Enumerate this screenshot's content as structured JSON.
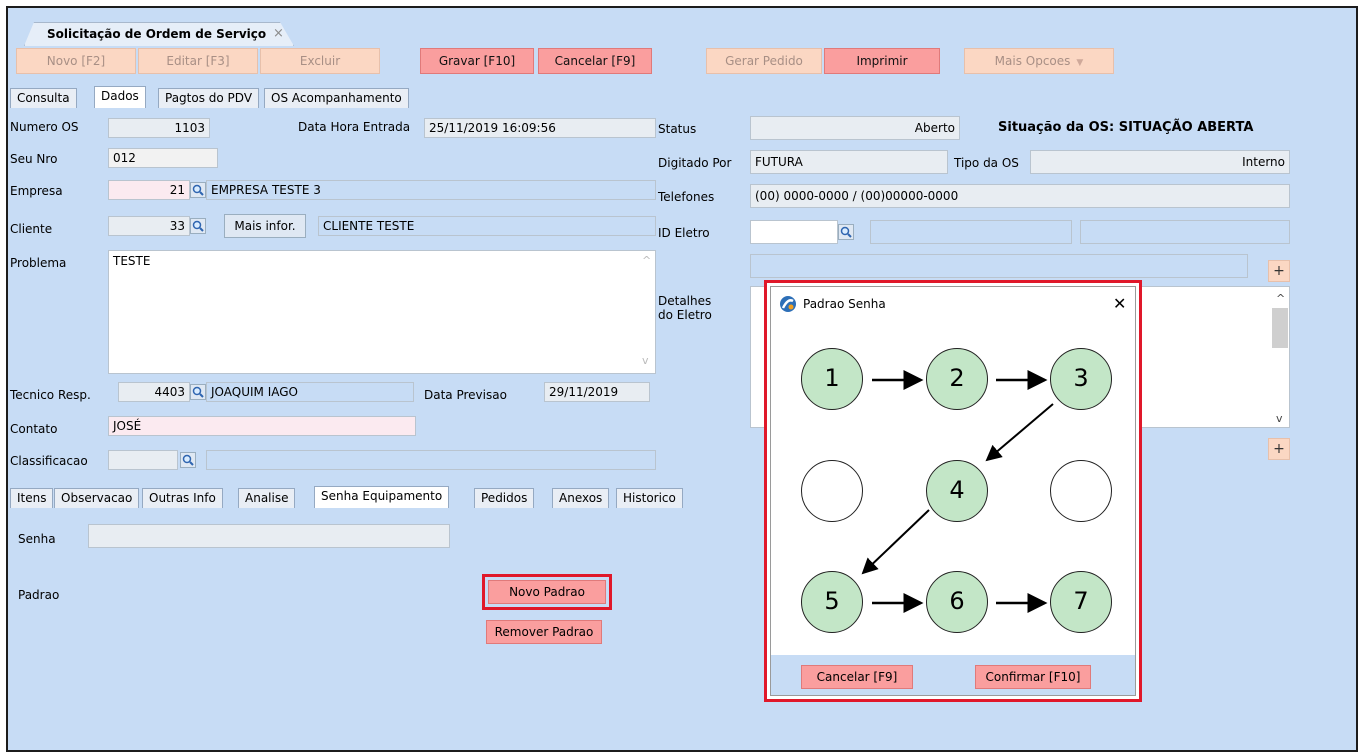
{
  "window_tab": {
    "title": "Solicitação de Ordem de Serviço",
    "close": "×"
  },
  "toolbar": {
    "novo": "Novo [F2]",
    "editar": "Editar [F3]",
    "excluir": "Excluir",
    "gravar": "Gravar [F10]",
    "cancelar": "Cancelar [F9]",
    "gerar_pedido": "Gerar Pedido",
    "imprimir": "Imprimir",
    "mais_opcoes": "Mais Opcoes",
    "dd": "▼"
  },
  "tabs": [
    "Consulta",
    "Dados",
    "Pagtos do PDV",
    "OS Acompanhamento"
  ],
  "form": {
    "numero_os_label": "Numero OS",
    "numero_os": "1103",
    "data_hora_label": "Data Hora Entrada",
    "data_hora": "25/11/2019 16:09:56",
    "seu_nro_label": "Seu Nro",
    "seu_nro": "012",
    "empresa_label": "Empresa",
    "empresa_cod": "21",
    "empresa_nome": "EMPRESA TESTE 3",
    "cliente_label": "Cliente",
    "cliente_cod": "33",
    "mais_infor": "Mais infor.",
    "cliente_nome": "CLIENTE TESTE",
    "problema_label": "Problema",
    "problema": "TESTE",
    "tecnico_label": "Tecnico Resp.",
    "tecnico_cod": "4403",
    "tecnico_nome": "JOAQUIM IAGO",
    "data_previsao_label": "Data Previsao",
    "data_previsao": "29/11/2019",
    "contato_label": "Contato",
    "contato": "JOSÉ",
    "classificacao_label": "Classificacao",
    "classificacao": ""
  },
  "right": {
    "status_label": "Status",
    "status": "Aberto",
    "situacao": "Situação da OS: SITUAÇÃO ABERTA",
    "digitado_label": "Digitado Por",
    "digitado": "FUTURA",
    "tipo_label": "Tipo da OS",
    "tipo": "Interno",
    "telefones_label": "Telefones",
    "telefones": "(00) 0000-0000 / (00)00000-0000",
    "id_eletro_label": "ID Eletro",
    "detalhes_label_1": "Detalhes",
    "detalhes_label_2": "do Eletro",
    "plus": "+"
  },
  "bottom_tabs": [
    "Itens",
    "Observacao",
    "Outras Info",
    "Analise",
    "Senha Equipamento",
    "Pedidos",
    "Anexos",
    "Historico"
  ],
  "senha": {
    "senha_label": "Senha",
    "senha": "",
    "padrao_label": "Padrao",
    "novo_padrao": "Novo Padrao",
    "remover_padrao": "Remover Padrao"
  },
  "dialog": {
    "title": "Padrao Senha",
    "close": "✕",
    "nodes": [
      "1",
      "2",
      "3",
      "",
      "4",
      "",
      "5",
      "6",
      "7"
    ],
    "cancel": "Cancelar [F9]",
    "confirm": "Confirmar [F10]"
  },
  "colors": {
    "background": "#c7dcf5",
    "button_active": "#fa9e9e",
    "button_disabled": "#fbd7c3",
    "node_fill": "#c3e6c7",
    "highlight": "#e0182a"
  }
}
